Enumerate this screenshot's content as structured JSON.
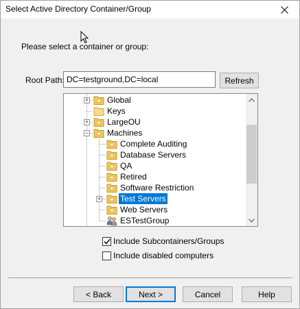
{
  "window": {
    "title": "Select Active Directory Container/Group"
  },
  "prompt": "Please select a container or group:",
  "root_path": {
    "label": "Root Path:",
    "value": "DC=testground,DC=local"
  },
  "refresh_label": "Refresh",
  "tree": {
    "items": [
      {
        "label": "Global",
        "icon": "folder-icon",
        "expander": "+"
      },
      {
        "label": "Keys",
        "icon": "folder-icon",
        "expander": ""
      },
      {
        "label": "LargeOU",
        "icon": "folder-icon",
        "expander": "+"
      },
      {
        "label": "Machines",
        "icon": "folder-icon",
        "expander": "-"
      },
      {
        "label": "Complete Auditing",
        "icon": "folder-icon",
        "expander": ""
      },
      {
        "label": "Database Servers",
        "icon": "folder-icon",
        "expander": ""
      },
      {
        "label": "QA",
        "icon": "folder-icon",
        "expander": ""
      },
      {
        "label": "Retired",
        "icon": "folder-icon",
        "expander": ""
      },
      {
        "label": "Software Restriction",
        "icon": "folder-icon",
        "expander": ""
      },
      {
        "label": "Test Servers",
        "icon": "folder-icon",
        "expander": "+",
        "selected": true
      },
      {
        "label": "Web Servers",
        "icon": "folder-icon",
        "expander": ""
      },
      {
        "label": "ESTestGroup",
        "icon": "group-icon",
        "expander": ""
      }
    ]
  },
  "options": {
    "include_subcontainers": {
      "label": "Include Subcontainers/Groups",
      "checked": true
    },
    "include_disabled": {
      "label": "Include disabled computers",
      "checked": false
    }
  },
  "buttons": {
    "back": "< Back",
    "next": "Next >",
    "cancel": "Cancel",
    "help": "Help"
  },
  "colors": {
    "selection": "#0078d7",
    "folder": "#f0c85a",
    "dialog_bg": "#f0f0f0"
  }
}
